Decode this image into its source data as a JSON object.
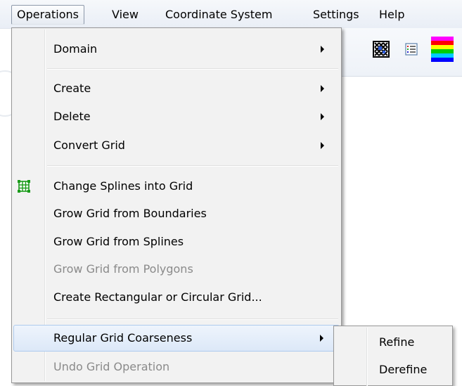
{
  "menubar": {
    "items": [
      {
        "label": "Operations"
      },
      {
        "label": "View"
      },
      {
        "label": "Coordinate System"
      },
      {
        "label": "Settings"
      },
      {
        "label": "Help"
      }
    ]
  },
  "toolbar": {
    "icons": [
      "grid-pattern-icon",
      "list-icon",
      "color-spectrum-icon"
    ]
  },
  "menu": {
    "items": [
      {
        "label": "Domain",
        "submenu": true,
        "enabled": true
      },
      {
        "label": "Create",
        "submenu": true,
        "enabled": true
      },
      {
        "label": "Delete",
        "submenu": true,
        "enabled": true
      },
      {
        "label": "Convert Grid",
        "submenu": true,
        "enabled": true
      },
      {
        "label": "Change Splines into Grid",
        "submenu": false,
        "enabled": true,
        "icon": "grid-icon"
      },
      {
        "label": "Grow Grid from Boundaries",
        "submenu": false,
        "enabled": true
      },
      {
        "label": "Grow Grid from Splines",
        "submenu": false,
        "enabled": true
      },
      {
        "label": "Grow Grid from Polygons",
        "submenu": false,
        "enabled": false
      },
      {
        "label": "Create Rectangular or Circular Grid...",
        "submenu": false,
        "enabled": true
      },
      {
        "label": "Regular Grid Coarseness",
        "submenu": true,
        "enabled": true,
        "highlighted": true
      },
      {
        "label": "Undo Grid Operation",
        "submenu": false,
        "enabled": false
      }
    ]
  },
  "submenu": {
    "items": [
      {
        "label": "Refine"
      },
      {
        "label": "Derefine"
      }
    ]
  },
  "colors": {
    "highlight_border": "#aecbee",
    "disabled_text": "#8a8a8a",
    "grid_icon": "#1a9b1a"
  }
}
